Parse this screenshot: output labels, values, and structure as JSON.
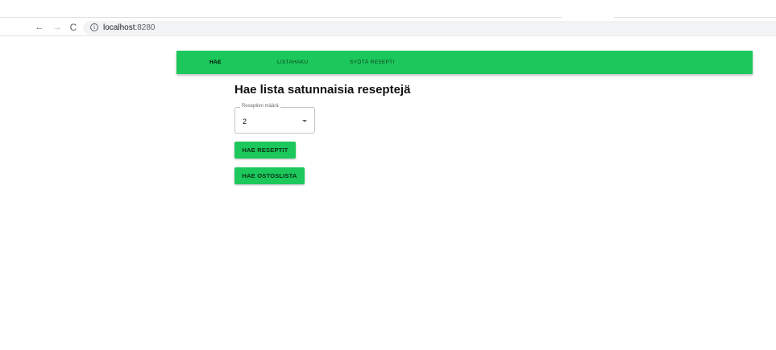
{
  "browser": {
    "nav_icons": {
      "back": "arrow-left-icon",
      "forward": "arrow-right-icon",
      "reload": "reload-icon",
      "site_info": "info-icon"
    },
    "back_glyph": "←",
    "forward_glyph": "→",
    "reload_glyph": "C",
    "info_glyph": "i",
    "url_host": "localhost",
    "url_port": ":8280"
  },
  "app": {
    "accent_color": "#1cc85b",
    "tabs": [
      {
        "label": "HAE",
        "active": true
      },
      {
        "label": "LISTAHAKU",
        "active": false
      },
      {
        "label": "SYÖTÄ RESEPTI",
        "active": false
      }
    ]
  },
  "main": {
    "title": "Hae lista satunnaisia reseptejä",
    "count_select": {
      "label": "Reseptien määrä",
      "value": "2"
    },
    "buttons": {
      "fetch_recipes": "HAE RESEPTIT",
      "fetch_shopping_list": "HAE OSTOSLISTA"
    }
  }
}
